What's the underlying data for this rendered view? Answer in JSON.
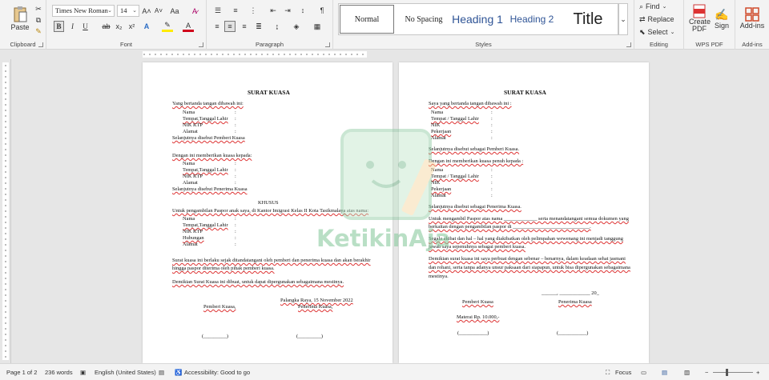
{
  "ribbon": {
    "clipboard": {
      "label": "Clipboard",
      "paste": "Paste"
    },
    "font": {
      "label": "Font",
      "family": "Times New Roman",
      "size": "14",
      "bold": "B",
      "italic": "I",
      "underline": "U"
    },
    "paragraph": {
      "label": "Paragraph"
    },
    "styles": {
      "label": "Styles",
      "items": [
        "Normal",
        "No Spacing",
        "Heading 1",
        "Heading 2",
        "Title"
      ]
    },
    "editing": {
      "label": "Editing",
      "find": "Find",
      "replace": "Replace",
      "select": "Select"
    },
    "wpspdf": {
      "label": "WPS PDF",
      "create": "Create PDF",
      "sign": "Sign"
    },
    "addins": {
      "label": "Add-ins",
      "addins": "Add-ins"
    }
  },
  "page1": {
    "title": "SURAT KUASA",
    "intro": "Yang bertanda tangan dibawah ini:",
    "f_nama": "Nama",
    "f_ttl": "Tempat,Tanggal Lahir",
    "f_nik": "NIK KTP",
    "f_alamat": "Alamat",
    "colon": ":",
    "sebut1": "Selanjutnya disebut Pemberi Kuasa",
    "dengan": "Dengan ini memberikan kuasa kepada:",
    "sebut2": "Selanjutnya disebut Penerima Kuasa",
    "khusus": "KHUSUS",
    "untuk": "Untuk pengambilan Paspor anak saya, di Kantor Imigrasi Kelas II Kota Tasikmalaya atas nama:",
    "f_hub": "Hubungan",
    "surat1": "Surat kuasa ini berlaku sejak ditandatangani oleh pemberi dan penerima kuasa dan akan berakhir",
    "surat2": "hingga paspor diterima oleh pihak pemberi kuasa.",
    "demikian": "Demikian Surat Kuasa ini dibuat, untuk dapat dipergunakan sebagaimana mestinya.",
    "place_date": "Palangka Raya, 15 November 2022",
    "pemberi": "Pemberi Kuasa,",
    "penerima": "Penerima Kuasa,",
    "sig": "(_________)"
  },
  "page2": {
    "title": "SURAT KUASA",
    "intro": "Saya yang bertanda tangan dibawah ini :",
    "f_nama": "Nama",
    "f_ttl": "Tempat / Tanggal Lahir",
    "f_nik": "NIK",
    "f_pek": "Pekerjaan",
    "f_alamat": "Alamat",
    "colon": ":",
    "sebut1": "Selanjutnya disebut sebagai Pemberi Kuasa.",
    "dengan": "Dengan ini memberikan kuasa penuh kepada :",
    "sebut2": "Selanjutnya disebut sebagai Penerima Kuasa.",
    "p1a": "Untuk mengambil Paspor atas nama _____________ serta menandatangani semua dokumen yang",
    "p1b": "berkaitan dengan pengambilan paspor di ______________________________.",
    "p2a": "Segala akibat dan hal – hal yang diakibatkan oleh pelimpahan wewenang ini menjadi tanggung",
    "p2b": "jawab saya sepenuhnya sebagai pemberi kuasa.",
    "p3a": "Demikian surat kuasa ini saya perbuat dengan sebenar – benarnya, dalam keadaan sehat jasmani",
    "p3b": "dan rohani, serta tanpa adanya unsur paksaan dari siapapun, untuk bisa dipergunakan sebagaimana",
    "p3c": "mestinya.",
    "date": "______, ____________ 20_",
    "pemberi": "Pemberi Kuasa",
    "penerima": "Penerima Kuasa",
    "materai": "Materai Rp. 10.000,-",
    "sig": "(___________)"
  },
  "watermark": "KetikinAja",
  "status": {
    "page": "Page 1 of 2",
    "words": "236 words",
    "lang": "English (United States)",
    "access": "Accessibility: Good to go",
    "focus": "Focus"
  },
  "colors": {
    "accent": "#2b579a",
    "ribbon": "#f3f3f3",
    "watermark": "#8ccaa0"
  }
}
